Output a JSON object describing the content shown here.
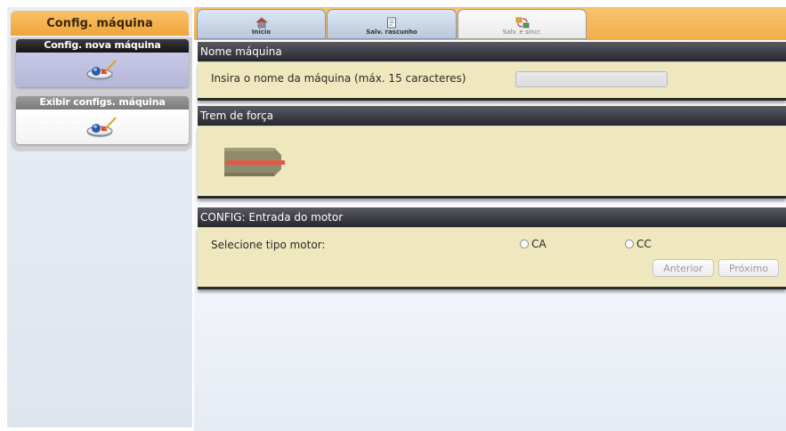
{
  "sidebar": {
    "header": "Config. máquina",
    "items": [
      {
        "label": "Config. nova máquina",
        "icon": "machine-config-icon",
        "active": true
      },
      {
        "label": "Exibir configs. máquina",
        "icon": "machine-view-icon",
        "active": false
      }
    ]
  },
  "tabs": [
    {
      "label": "Início",
      "icon": "home-icon"
    },
    {
      "label": "Salv. rascunho",
      "icon": "save-draft-icon"
    },
    {
      "label": "Salv. e sincr.",
      "icon": "save-sync-icon"
    }
  ],
  "sections": {
    "machine_name": {
      "title": "Nome máquina",
      "prompt": "Insira o nome da máquina (máx. 15 caracteres)",
      "value": ""
    },
    "drivetrain": {
      "title": "Trem de força",
      "image": "motor-icon"
    },
    "motor_input": {
      "title": "CONFIG: Entrada do motor",
      "prompt": "Selecione tipo motor:",
      "options": [
        "CA",
        "CC"
      ],
      "back_label": "Anterior",
      "next_label": "Próximo"
    }
  },
  "colors": {
    "accent_orange": "#f3ad48",
    "section_header": "#2e2e35",
    "section_body": "#efe7bd"
  }
}
